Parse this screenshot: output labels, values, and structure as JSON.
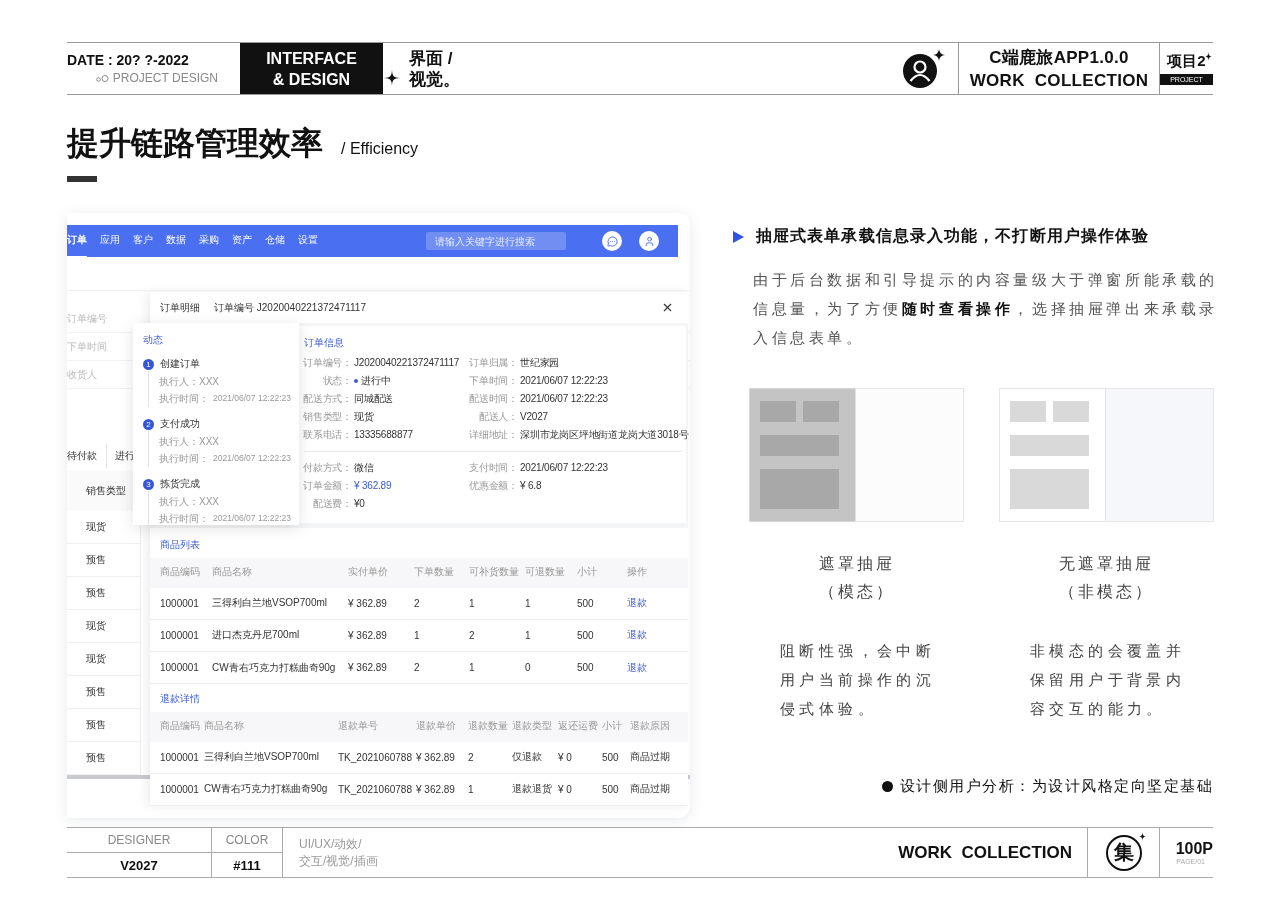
{
  "header": {
    "date": "DATE : 20? ?-2022",
    "subtitle": "PROJECT DESIGN",
    "badge": [
      "INTERFACE",
      "& DESIGN"
    ],
    "category": [
      "界面 /",
      "视觉。"
    ],
    "app_name": "C端鹿旅APP1.0.0",
    "collection": "WORK  COLLECTION",
    "project": "项目2",
    "project_tag": "PROJECT"
  },
  "title": {
    "text": "提升链路管理效率",
    "subtitle": "/ Efficiency"
  },
  "mockup": {
    "nav": {
      "tabs": [
        {
          "label": "订单",
          "selected": true
        },
        {
          "label": "应用",
          "selected": false
        },
        {
          "label": "客户",
          "selected": false
        },
        {
          "label": "数据",
          "selected": false
        },
        {
          "label": "采购",
          "selected": false
        },
        {
          "label": "资产",
          "selected": false
        },
        {
          "label": "仓储",
          "selected": false
        },
        {
          "label": "设置",
          "selected": false
        }
      ],
      "search_placeholder": "请输入关键字进行搜索"
    },
    "filters": [
      "订单编号",
      "下单时间",
      "收货人"
    ],
    "status_tabs": [
      "待付款",
      "进行"
    ],
    "table": {
      "column": "销售类型",
      "rows": [
        "现货",
        "预售",
        "预售",
        "现货",
        "现货",
        "预售",
        "预售",
        "预售"
      ]
    },
    "drawer": {
      "title": "订单明细",
      "order_no": "订单编号 J2020040221372471117",
      "info_title": "订单信息",
      "info": [
        {
          "label": "订单编号：",
          "value": "J2020040221372471117",
          "kind": "text"
        },
        {
          "label": "订单归属：",
          "value": "世纪家园",
          "kind": "text"
        },
        {
          "label": "状态：",
          "value": "进行中",
          "kind": "status"
        },
        {
          "label": "下单时间：",
          "value": "2021/06/07 12:22:23",
          "kind": "text"
        },
        {
          "label": "配送方式：",
          "value": "同城配送",
          "kind": "text"
        },
        {
          "label": "配送时间：",
          "value": "2021/06/07 12:22:23",
          "kind": "text"
        },
        {
          "label": "销售类型：",
          "value": "现货",
          "kind": "text"
        },
        {
          "label": "配送人：",
          "value": "V2027",
          "kind": "text"
        },
        {
          "label": "联系电话：",
          "value": "13335688877",
          "kind": "text"
        },
        {
          "label": "详细地址：",
          "value": "深圳市龙岗区坪地街道龙岗大道3018号",
          "kind": "text"
        }
      ],
      "payment": [
        {
          "label": "付款方式：",
          "value": "微信",
          "kind": "text"
        },
        {
          "label": "支付时间：",
          "value": "2021/06/07 12:22:23",
          "kind": "text"
        },
        {
          "label": "订单金额：",
          "value": "¥ 362.89",
          "kind": "amount"
        },
        {
          "label": "优惠金额：",
          "value": "¥ 6.8",
          "kind": "text"
        },
        {
          "label": "配送费：",
          "value": "¥0",
          "kind": "text"
        }
      ],
      "products": {
        "title": "商品列表",
        "columns": [
          "商品编码",
          "商品名称",
          "实付单价",
          "下单数量",
          "可补货数量",
          "可退数量",
          "小计",
          "操作"
        ],
        "rows": [
          {
            "cells": [
              "1000001",
              "三得利白兰地VSOP700ml",
              "¥ 362.89",
              "2",
              "1",
              "1",
              "500"
            ],
            "action": "退款"
          },
          {
            "cells": [
              "1000001",
              "进口杰克丹尼700ml",
              "¥ 362.89",
              "1",
              "2",
              "1",
              "500"
            ],
            "action": "退款"
          },
          {
            "cells": [
              "1000001",
              "CW青右巧克力打糕曲奇90g",
              "¥ 362.89",
              "2",
              "1",
              "0",
              "500"
            ],
            "action": "退款"
          }
        ]
      },
      "refunds": {
        "title": "退款详情",
        "columns": [
          "商品编码",
          "商品名称",
          "退款单号",
          "退款单价",
          "退款数量",
          "退款类型",
          "返还运费",
          "小计",
          "退款原因"
        ],
        "rows": [
          [
            "1000001",
            "三得利白兰地VSOP700ml",
            "TK_2021060788",
            "¥ 362.89",
            "2",
            "仅退款",
            "¥ 0",
            "500",
            "商品过期"
          ],
          [
            "1000001",
            "CW青右巧克力打糕曲奇90g",
            "TK_2021060788",
            "¥ 362.89",
            "1",
            "退款退货",
            "¥ 0",
            "500",
            "商品过期"
          ]
        ]
      }
    },
    "timeline": {
      "title": "动态",
      "steps": [
        {
          "number": "1",
          "name": "创建订单",
          "executor": "执行人：XXX",
          "time_label": "执行时间：",
          "time": "2021/06/07 12:22:23"
        },
        {
          "number": "2",
          "name": "支付成功",
          "executor": "执行人：XXX",
          "time_label": "执行时间：",
          "time": "2021/06/07 12:22:23"
        },
        {
          "number": "3",
          "name": "拣货完成",
          "executor": "执行人：XXX",
          "time_label": "执行时间：",
          "time": "2021/06/07 12:22:23"
        }
      ]
    }
  },
  "feature": {
    "heading": "抽屉式表单承载信息录入功能，不打断用户操作体验",
    "body": "由于后台数据和引导提示的内容量级大于弹窗所能承载的信息量，为了方便**随时查看操作**，选择抽屉弹出来承载录入信息表单。",
    "options": [
      {
        "kind": "modal",
        "name": "遮罩抽屉",
        "note": "（模态）",
        "desc": "阻断性强，会中断用户当前操作的沉侵式体验。"
      },
      {
        "kind": "modeless",
        "name": "无遮罩抽屉",
        "note": "（非模态）",
        "desc": "非模态的会覆盖并保留用户于背景内容交互的能力。"
      }
    ]
  },
  "tagline": "设计侧用户分析：为设计风格定向坚定基础",
  "footer": {
    "designer_label": "DESIGNER",
    "designer": "V2027",
    "color_label": "COLOR",
    "color_value": "#111",
    "tags": [
      "UI/UX/动效/",
      "交互/视觉/插画"
    ],
    "collection": "WORK  COLLECTION",
    "badge": "集",
    "pages": "100P",
    "page_no": "PAGE/01"
  }
}
